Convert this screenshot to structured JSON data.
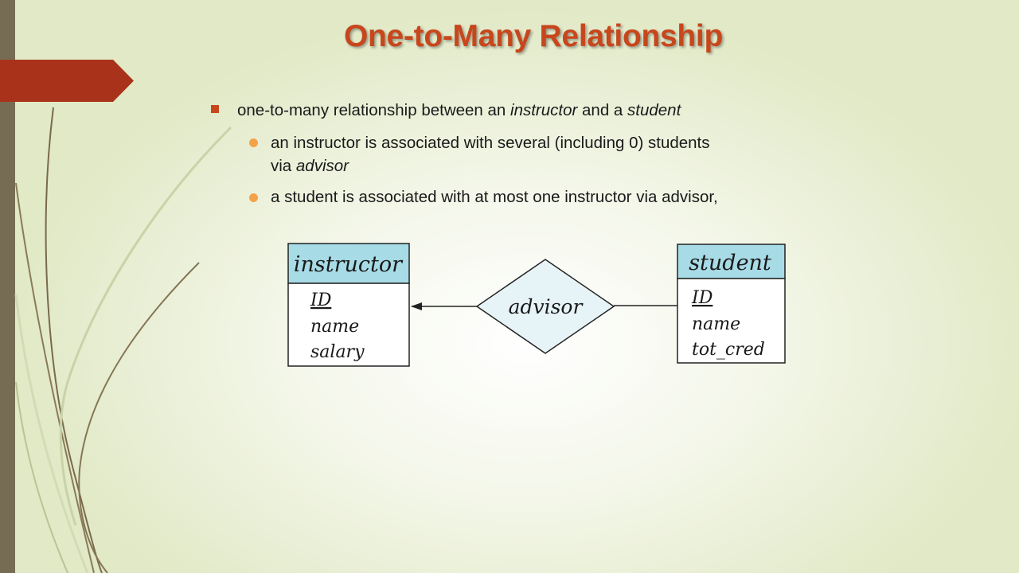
{
  "slide": {
    "title": "One-to-Many Relationship",
    "bullet1": {
      "prefix": "one-to-many relationship between an ",
      "em1": "instructor",
      "middle": " and a ",
      "em2": "student"
    },
    "sub1": {
      "line1": " an instructor is associated with several (including 0) students",
      "line2_prefix": "via ",
      "line2_em": "advisor"
    },
    "sub2": {
      "text": "a student is associated with at most one instructor via advisor,"
    }
  },
  "diagram": {
    "instructor": {
      "name": "instructor",
      "attributes": [
        "ID",
        "name",
        "salary"
      ]
    },
    "student": {
      "name": "student",
      "attributes": [
        "ID",
        "name",
        "tot_cred"
      ]
    },
    "relationship": "advisor",
    "colors": {
      "entity_header": "#a7dbe6",
      "relationship_fill": "#e6f4f8",
      "line": "#222222"
    }
  },
  "theme": {
    "title_color": "#c8461c",
    "accent": "#a8331a",
    "bullet_dot": "#f4a24a",
    "sidebar": "#766c53"
  }
}
